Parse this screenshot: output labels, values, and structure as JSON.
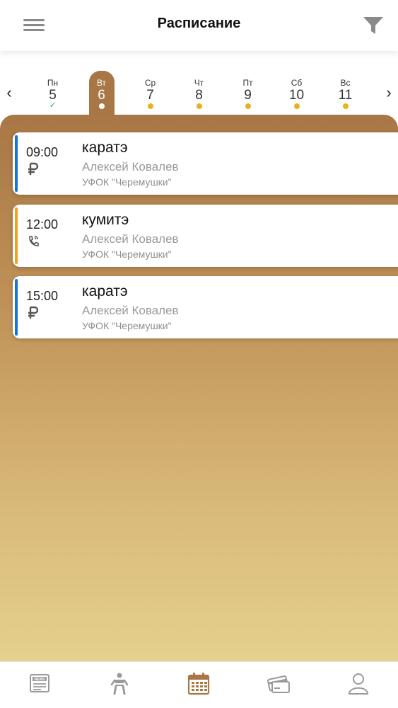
{
  "header": {
    "title": "Расписание"
  },
  "week": {
    "days": [
      {
        "name": "Пн",
        "date": "5",
        "marker": "check",
        "active": false
      },
      {
        "name": "Вт",
        "date": "6",
        "marker": "dot",
        "active": true
      },
      {
        "name": "Ср",
        "date": "7",
        "marker": "dot",
        "active": false
      },
      {
        "name": "Чт",
        "date": "8",
        "marker": "dot",
        "active": false
      },
      {
        "name": "Пт",
        "date": "9",
        "marker": "dot",
        "active": false
      },
      {
        "name": "Сб",
        "date": "10",
        "marker": "dot",
        "active": false
      },
      {
        "name": "Вс",
        "date": "11",
        "marker": "dot",
        "active": false
      }
    ],
    "prev_glyph": "‹",
    "next_glyph": "›",
    "check_glyph": "✓"
  },
  "classes": [
    {
      "time": "09:00",
      "name": "каратэ",
      "coach": "Алексей Ковалев",
      "place": "УФОК \"Черемушки\"",
      "icon": "ruble-icon",
      "accent": "#1b72d6"
    },
    {
      "time": "12:00",
      "name": "кумитэ",
      "coach": "Алексей Ковалев",
      "place": "УФОК \"Черемушки\"",
      "icon": "phone-icon",
      "accent": "#f0a020"
    },
    {
      "time": "15:00",
      "name": "каратэ",
      "coach": "Алексей Ковалев",
      "place": "УФОК \"Черемушки\"",
      "icon": "ruble-icon",
      "accent": "#1b72d6"
    }
  ],
  "bottom_nav": [
    {
      "icon": "news-icon",
      "label": "NEWS",
      "active": false
    },
    {
      "icon": "karate-icon",
      "active": false
    },
    {
      "icon": "calendar-icon",
      "active": true
    },
    {
      "icon": "cards-icon",
      "active": false
    },
    {
      "icon": "profile-icon",
      "active": false
    }
  ],
  "colors": {
    "brand": "#a87745",
    "dot": "#e8b31a",
    "check": "#1aa07f",
    "nav_inactive": "#9a9a9a"
  }
}
